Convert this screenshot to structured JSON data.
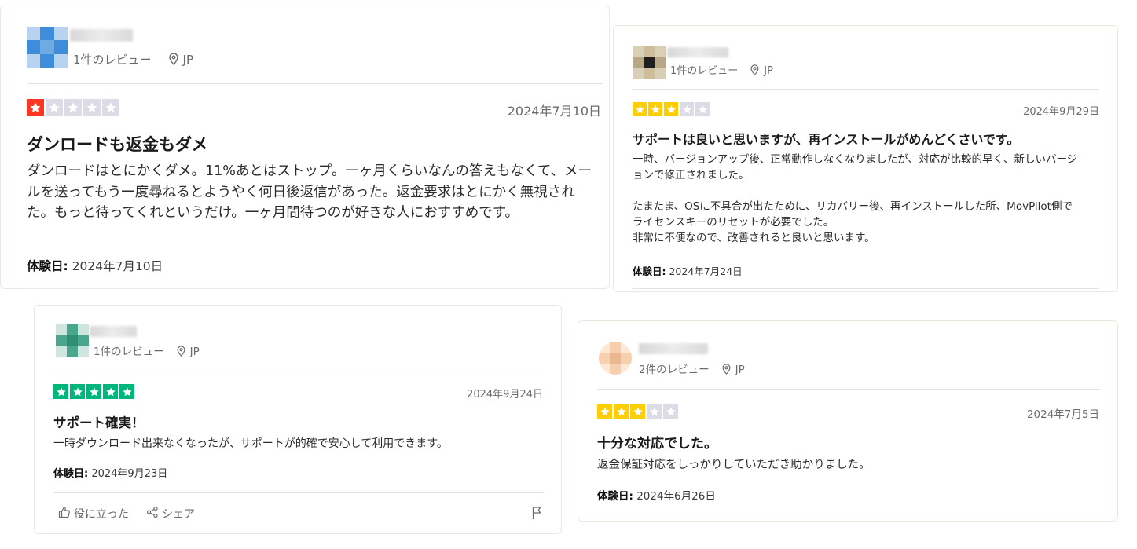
{
  "reviews": [
    {
      "review_count": "1件のレビュー",
      "location": "JP",
      "rating": 1,
      "star_color": "#ff3722",
      "date": "2024年7月10日",
      "title": "ダンロードも返金もダメ",
      "body": "ダンロードはとにかくダメ。11%あとはストップ。一ヶ月くらいなんの答えもなくて、メールを送ってもう一度尋ねるとようやく何日後返信があった。返金要求はとにかく無視された。もっと待ってくれというだけ。一ヶ月間待つのが好きな人におすすめです。",
      "experience_label": "体験日:",
      "experience_date": "2024年7月10日"
    },
    {
      "review_count": "1件のレビュー",
      "location": "JP",
      "rating": 3,
      "star_color": "#ffce00",
      "date": "2024年9月29日",
      "title": "サポートは良いと思いますが、再インストールがめんどくさいです。",
      "body": "一時、バージョンアップ後、正常動作しなくなりましたが、対応が比較的早く、新しいバージョンで修正されました。\n\nたまたま、OSに不具合が出たために、リカバリー後、再インストールした所、MovPilot側でライセンスキーのリセットが必要でした。\n非常に不便なので、改善されると良いと思います。",
      "experience_label": "体験日:",
      "experience_date": "2024年7月24日"
    },
    {
      "review_count": "1件のレビュー",
      "location": "JP",
      "rating": 5,
      "star_color": "#00b67a",
      "date": "2024年9月24日",
      "title": "サポート確実！",
      "body": "一時ダウンロード出来なくなったが、サポートが的確で安心して利用できます。",
      "experience_label": "体験日:",
      "experience_date": "2024年9月23日",
      "helpful_label": "役に立った",
      "share_label": "シェア"
    },
    {
      "review_count": "2件のレビュー",
      "location": "JP",
      "rating": 3,
      "star_color": "#ffce00",
      "date": "2024年7月5日",
      "title": "十分な対応でした。",
      "body": "返金保証対応をしっかりしていただき助かりました。",
      "experience_label": "体験日:",
      "experience_date": "2024年6月26日"
    }
  ],
  "avatar_palettes": [
    [
      "#b7d3ef",
      "#3d8ddb",
      "#b7d3ef",
      "#3d8ddb",
      "#6faae3",
      "#3d8ddb",
      "#b7d3ef",
      "#3d8ddb",
      "#b7d3ef"
    ],
    [
      "#d9ceb6",
      "#cdbd9a",
      "#d9ceb6",
      "#b8a887",
      "#1e1e1e",
      "#b8a887",
      "#d9ceb6",
      "#cdbd9a",
      "#d9ceb6"
    ],
    [
      "#cfe6df",
      "#4aa68c",
      "#cfe6df",
      "#4aa68c",
      "#2f8f76",
      "#4aa68c",
      "#cfe6df",
      "#4aa68c",
      "#cfe6df"
    ],
    [
      "#fde8d6",
      "#f6cfaf",
      "#fde8d6",
      "#f6cfaf",
      "#e9b891",
      "#f6cfaf",
      "#fde8d6",
      "#f6cfaf",
      "#fde8d6"
    ]
  ],
  "icons": {
    "location": "location-pin-icon",
    "star": "star-icon",
    "thumbs_up": "thumbs-up-icon",
    "share": "share-icon",
    "flag": "flag-icon"
  }
}
